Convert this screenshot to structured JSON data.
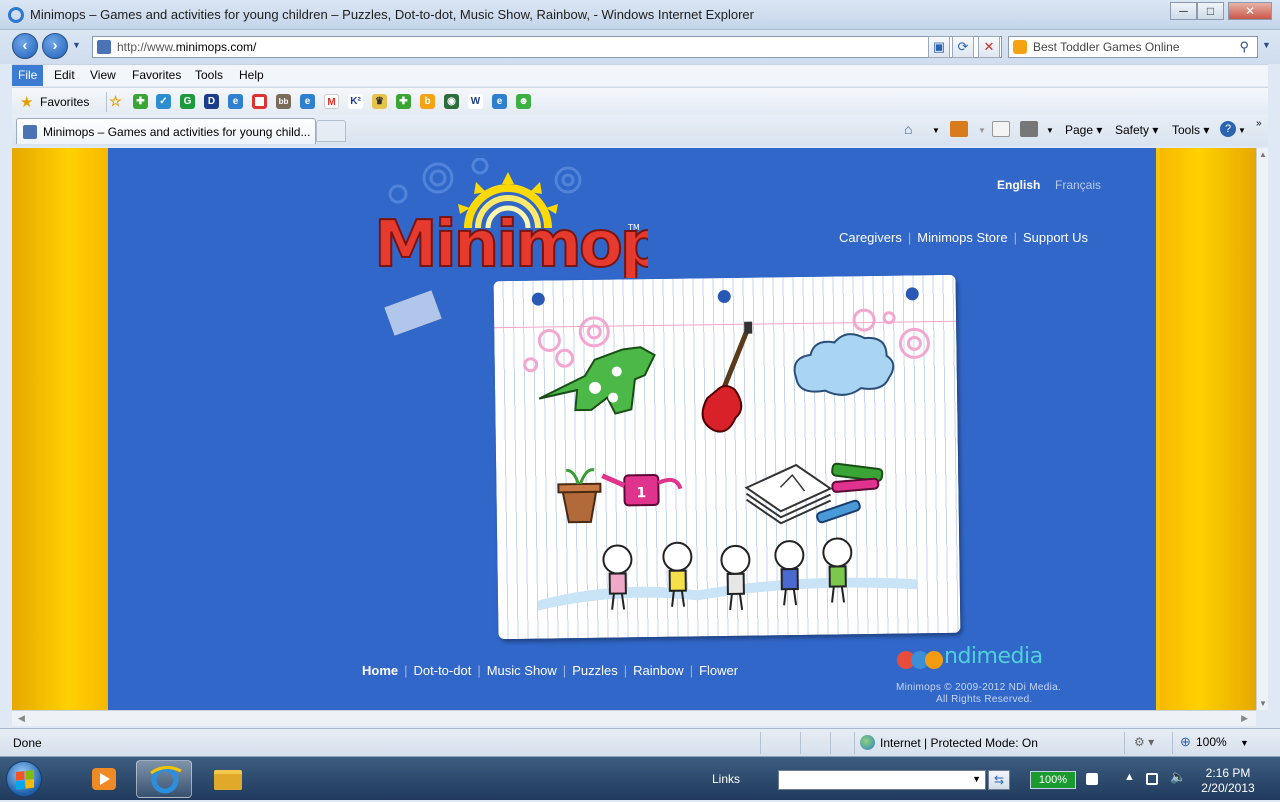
{
  "window": {
    "title": "Minimops – Games and activities for young children – Puzzles, Dot-to-dot, Music Show, Rainbow,  - Windows Internet Explorer",
    "minimize": "─",
    "maximize": "□",
    "close": "✕"
  },
  "address_bar": {
    "url_prefix": "http://www.",
    "url_host": "minimops.com/",
    "search_placeholder": "Best Toddler Games Online"
  },
  "menu": [
    "File",
    "Edit",
    "View",
    "Favorites",
    "Tools",
    "Help"
  ],
  "favorites_bar": {
    "label": "Favorites"
  },
  "tabs": {
    "active_title": "Minimops – Games and activities for young child..."
  },
  "command_bar": {
    "page": "Page",
    "safety": "Safety",
    "tools": "Tools"
  },
  "site": {
    "languages": {
      "en": "English",
      "fr": "Français"
    },
    "toplinks": [
      "Caregivers",
      "Minimops Store",
      "Support Us"
    ],
    "logo_text": "Minimops",
    "nav": [
      "Home",
      "Dot-to-dot",
      "Music Show",
      "Puzzles",
      "Rainbow",
      "Flower"
    ],
    "footer": {
      "brand": "ndimedia",
      "copyright": "Minimops © 2009-2012 NDi Media.",
      "rights": "All Rights Reserved."
    }
  },
  "status_bar": {
    "status": "Done",
    "zone": "Internet | Protected Mode: On",
    "zoom": "100%"
  },
  "taskbar": {
    "links_label": "Links",
    "battery": "100%",
    "time": "2:16 PM",
    "date": "2/20/2013"
  },
  "colors": {
    "site_blue": "#3167c9",
    "side_yellow": "#ffd100",
    "ie_chrome": "#dbe6f3"
  }
}
